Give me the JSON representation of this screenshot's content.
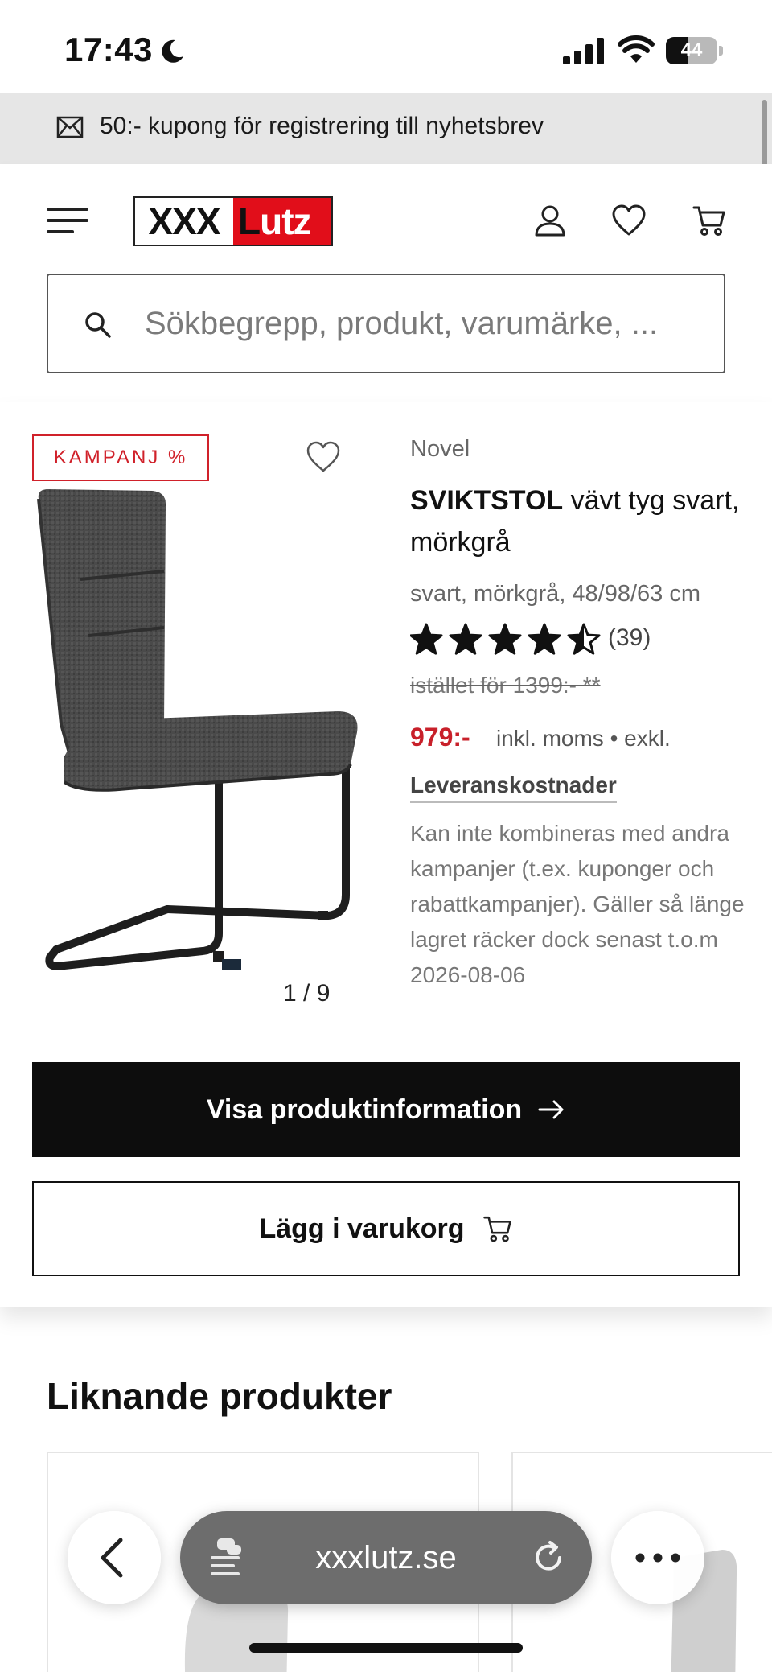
{
  "status_bar": {
    "time": "17:43",
    "battery": "44",
    "battery_level": 0.44
  },
  "promo": {
    "text": "50:- kupong för registrering till nyhetsbrev"
  },
  "header": {
    "logo_xxx": "XXX",
    "logo_l": "L",
    "logo_utz": "utz",
    "search_placeholder": "Sökbegrepp, produkt, varumärke, ..."
  },
  "product": {
    "badge": "KAMPANJ %",
    "brand": "Novel",
    "name_bold": "SVIKTSTOL",
    "name_rest": " vävt tyg svart, mörkgrå",
    "variant": "svart, mörkgrå, 48/98/63 cm",
    "rating": 4.5,
    "reviews": "(39)",
    "old_price": "istället för 1399:- **",
    "price": "979:-",
    "vat": "inkl. moms • exkl.",
    "shipping": "Leveranskostnader",
    "note": "Kan inte kombineras med andra kampanjer (t.ex. kuponger och rabattkampanjer). Gäller så länge lagret räcker dock senast t.o.m 2026-08-06",
    "image_pager": "1 / 9",
    "btn_info": "Visa produktinformation",
    "btn_cart": "Lägg i varukorg"
  },
  "similar": {
    "title": "Liknande produkter"
  },
  "browser": {
    "url": "xxxlutz.se"
  },
  "colors": {
    "accent_red": "#e10e1a",
    "price_red": "#c8202a",
    "primary_button": "#0d0d0d"
  }
}
